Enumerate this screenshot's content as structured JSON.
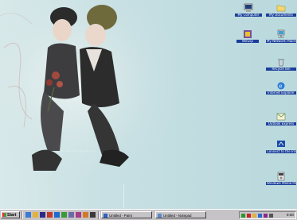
{
  "desktop": {
    "icons": [
      {
        "name": "my-computer-icon",
        "label": "My Computer"
      },
      {
        "name": "my-documents-icon",
        "label": "My Documents"
      },
      {
        "name": "winzip-icon",
        "label": "WinZip"
      },
      {
        "name": "network-icon",
        "label": "My Network Places"
      },
      {
        "name": "recycle-bin-icon",
        "label": "Recycle Bin"
      },
      {
        "name": "internet-explorer-icon",
        "label": "Internet Explorer"
      },
      {
        "name": "outlook-express-icon",
        "label": "Outlook Express"
      },
      {
        "name": "connect-to-internet-icon",
        "label": "Connect to the Internet"
      },
      {
        "name": "media-player-icon",
        "label": "Windows Media Player"
      }
    ]
  },
  "taskbar": {
    "start_label": "Start",
    "tasks": [
      {
        "label": "Untitled - Paint"
      },
      {
        "label": "Untitled - Notepad"
      }
    ],
    "clock": "9:00"
  }
}
